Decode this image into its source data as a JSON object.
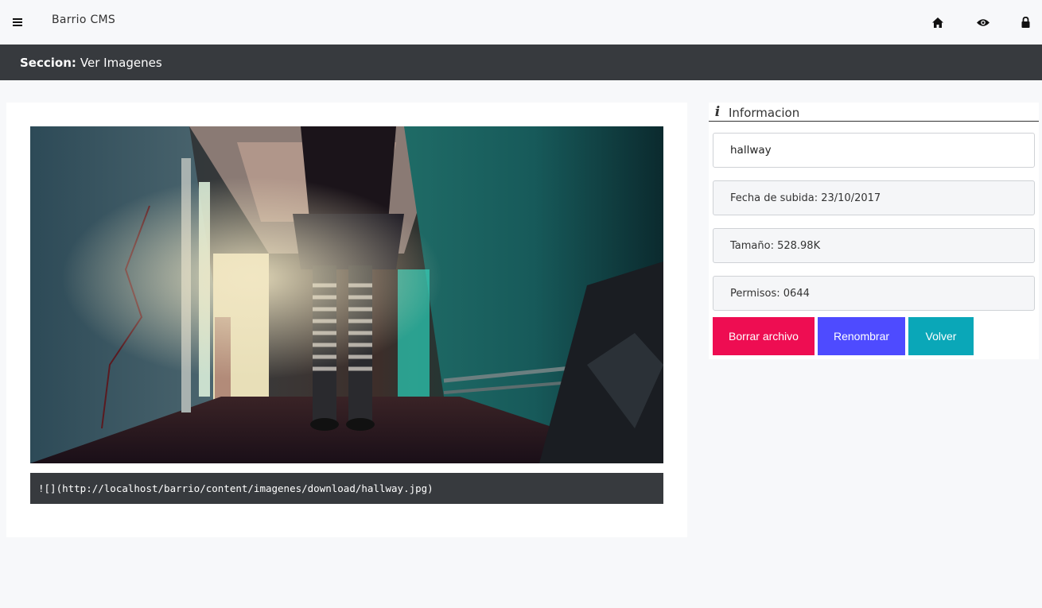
{
  "app": {
    "title": "Barrio CMS"
  },
  "topbar": {
    "menu_icon": "hamburger-menu-icon",
    "icons": [
      "home-icon",
      "eye-icon",
      "lock-icon"
    ]
  },
  "section": {
    "label": "Seccion:",
    "name": "Ver Imagenes"
  },
  "image": {
    "alt": "hallway",
    "markdown": "![](http://localhost/barrio/content/imagenes/download/hallway.jpg)"
  },
  "info": {
    "title": "Informacion",
    "icon": "info-icon",
    "name_value": "hallway",
    "upload_date": "Fecha de subida: 23/10/2017",
    "size": "Tamaño: 528.98K",
    "permissions": "Permisos: 0644"
  },
  "actions": {
    "delete_label": "Borrar archivo",
    "rename_label": "Renombrar",
    "back_label": "Volver"
  },
  "colors": {
    "section_bar": "#373a3e",
    "delete": "#ee0d52",
    "rename": "#4e4bff",
    "back": "#0aa7b8"
  }
}
